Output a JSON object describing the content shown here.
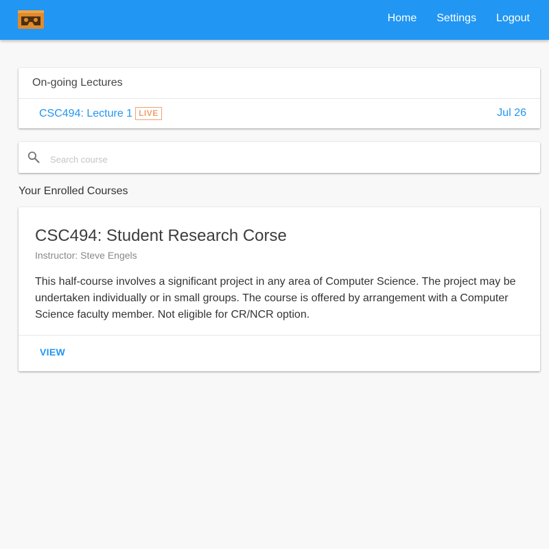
{
  "header": {
    "logo_icon": "cardboard-vr-headset-icon",
    "nav": [
      {
        "label": "Home"
      },
      {
        "label": "Settings"
      },
      {
        "label": "Logout"
      }
    ],
    "bar_color": "#2196f3"
  },
  "ongoing": {
    "title": "On-going Lectures",
    "lectures": [
      {
        "name": "CSC494: Lecture 1",
        "badge": "LIVE",
        "date": "Jul 26"
      }
    ]
  },
  "search": {
    "icon": "search-icon",
    "placeholder": "Search course",
    "value": ""
  },
  "enrolled": {
    "title": "Your Enrolled Courses",
    "courses": [
      {
        "title": "CSC494: Student Research Corse",
        "instructor": "Instructor: Steve Engels",
        "description": "This half-course involves a significant project in any area of Computer Science. The project may be undertaken individually or in small groups. The course is offered by arrangement with a Computer Science faculty member. Not eligible for CR/NCR option.",
        "action": "VIEW"
      }
    ]
  },
  "colors": {
    "accent": "#2196f3",
    "live_badge": "#f0a070",
    "background": "#f8f8f8"
  }
}
